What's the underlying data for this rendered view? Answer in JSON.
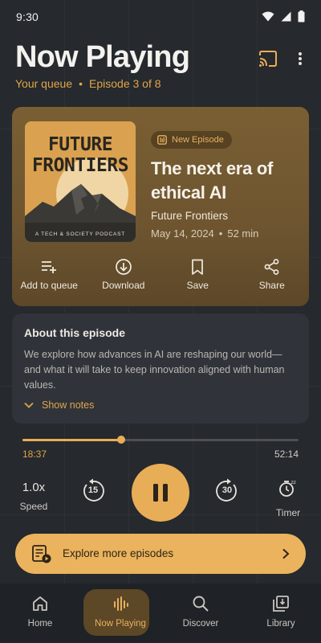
{
  "status_bar": {
    "time": "9:30"
  },
  "header": {
    "title": "Now Playing",
    "queue_label": "Your queue",
    "separator": "•",
    "episode_position": "Episode 3 of 8"
  },
  "episode": {
    "cover": {
      "title_line1": "FUTURE",
      "title_line2": "FRONTIERS",
      "tagline": "A TECH & SOCIETY PODCAST"
    },
    "badge": "New Episode",
    "title": "The next era of ethical AI",
    "show": "Future Frontiers",
    "date": "May 14, 2024",
    "meta_separator": "•",
    "duration": "52 min",
    "actions": [
      {
        "label": "Add to queue",
        "icon": "playlist-add-icon"
      },
      {
        "label": "Download",
        "icon": "download-icon"
      },
      {
        "label": "Save",
        "icon": "bookmark-icon"
      },
      {
        "label": "Share",
        "icon": "share-icon"
      }
    ]
  },
  "about": {
    "title": "About this episode",
    "text": "We explore how advances in AI are reshaping our world—and what it will take to keep innovation aligned with human values.",
    "show_notes": "Show notes"
  },
  "player": {
    "elapsed": "18:37",
    "total": "52:14",
    "progress": 0.357,
    "speed": "1.0x",
    "speed_label": "Speed",
    "rewind_seconds": "15",
    "forward_seconds": "30",
    "timer_label": "Timer",
    "state": "playing"
  },
  "explore": {
    "label": "Explore more episodes"
  },
  "nav": {
    "items": [
      {
        "label": "Home",
        "icon": "home-icon"
      },
      {
        "label": "Now Playing",
        "icon": "equalizer-icon"
      },
      {
        "label": "Discover",
        "icon": "search-icon"
      },
      {
        "label": "Library",
        "icon": "library-icon"
      }
    ],
    "active_index": 1
  },
  "colors": {
    "accent": "#e8ad57",
    "background": "#26292d",
    "card": "#30343a",
    "episode_card": "#6e5530",
    "nav_background": "#1f2226"
  }
}
